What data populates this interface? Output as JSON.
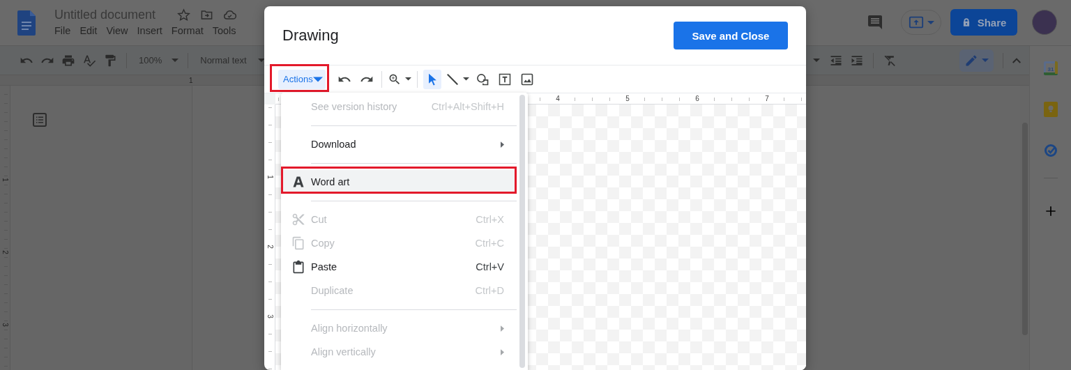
{
  "docs": {
    "title": "Untitled document",
    "menu": [
      "File",
      "Edit",
      "View",
      "Insert",
      "Format",
      "Tools"
    ],
    "toolbar": {
      "zoom": "100%",
      "style": "Normal text"
    },
    "share_button": "Share",
    "ruler": {
      "horizontal": [
        "1"
      ],
      "vertical": [
        "1",
        "2",
        "3"
      ]
    },
    "side_panel": {
      "calendar_day": "31"
    }
  },
  "dialog": {
    "title": "Drawing",
    "save_button": "Save and Close",
    "toolbar": [
      {
        "kind": "actions",
        "label": "Actions",
        "selected": true,
        "annotated": true
      },
      {
        "kind": "undo"
      },
      {
        "kind": "redo"
      },
      {
        "kind": "divider"
      },
      {
        "kind": "zoom"
      },
      {
        "kind": "divider"
      },
      {
        "kind": "select",
        "selected": true
      },
      {
        "kind": "line",
        "selected": false
      },
      {
        "kind": "shape",
        "selected": false
      },
      {
        "kind": "textbox",
        "selected": false
      },
      {
        "kind": "image",
        "selected": false
      }
    ],
    "ruler": {
      "horizontal": [
        "4",
        "5",
        "6",
        "7"
      ],
      "vertical": [
        "1",
        "2",
        "3"
      ]
    },
    "menu": {
      "groups": [
        [
          {
            "kind": "plain",
            "label": "See version history",
            "shortcut": "Ctrl+Alt+Shift+H",
            "disabled": true,
            "selected": false,
            "annotated": false
          }
        ],
        [
          {
            "kind": "plain",
            "label": "Download",
            "disabled": false,
            "submenu": true,
            "selected": false,
            "annotated": false
          }
        ],
        [
          {
            "kind": "wordart",
            "label": "Word art",
            "disabled": false,
            "selected": true,
            "annotated": true
          }
        ],
        [
          {
            "kind": "cut",
            "label": "Cut",
            "shortcut": "Ctrl+X",
            "disabled": true,
            "selected": false,
            "annotated": false
          },
          {
            "kind": "copy",
            "label": "Copy",
            "shortcut": "Ctrl+C",
            "disabled": true,
            "selected": false,
            "annotated": false
          },
          {
            "kind": "paste",
            "label": "Paste",
            "shortcut": "Ctrl+V",
            "disabled": false,
            "selected": false,
            "annotated": false
          },
          {
            "kind": "plain",
            "label": "Duplicate",
            "shortcut": "Ctrl+D",
            "disabled": true,
            "selected": false,
            "annotated": false
          }
        ],
        [
          {
            "kind": "plain",
            "label": "Align horizontally",
            "disabled": true,
            "submenu": true,
            "selected": false,
            "annotated": false
          },
          {
            "kind": "plain",
            "label": "Align vertically",
            "disabled": true,
            "submenu": true,
            "selected": false,
            "annotated": false
          }
        ]
      ]
    }
  }
}
